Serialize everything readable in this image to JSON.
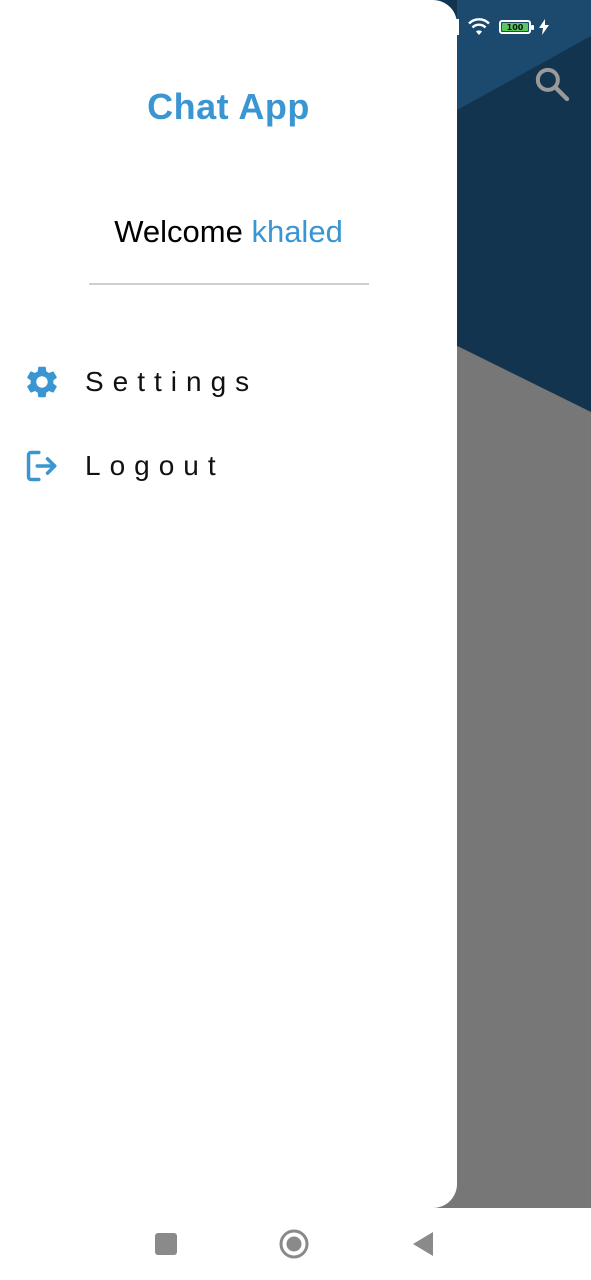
{
  "drawer": {
    "title": "Chat App",
    "welcome_prefix": "Welcome",
    "username": "khaled",
    "menu": [
      {
        "label": "Settings",
        "icon": "gear-icon"
      },
      {
        "label": "Logout",
        "icon": "logout-icon"
      }
    ]
  },
  "status_bar": {
    "battery_level": "100",
    "icons": [
      "wifi-icon",
      "battery-icon",
      "charging-icon"
    ]
  },
  "background_app": {
    "icons": [
      "search-icon"
    ]
  },
  "nav_bar": {
    "icons": [
      "recents-icon",
      "home-icon",
      "back-icon"
    ]
  },
  "colors": {
    "accent": "#3a96d2",
    "header_dark": "#13344f",
    "header_mid": "#1c4a6e",
    "scrim_gray": "#777777"
  }
}
